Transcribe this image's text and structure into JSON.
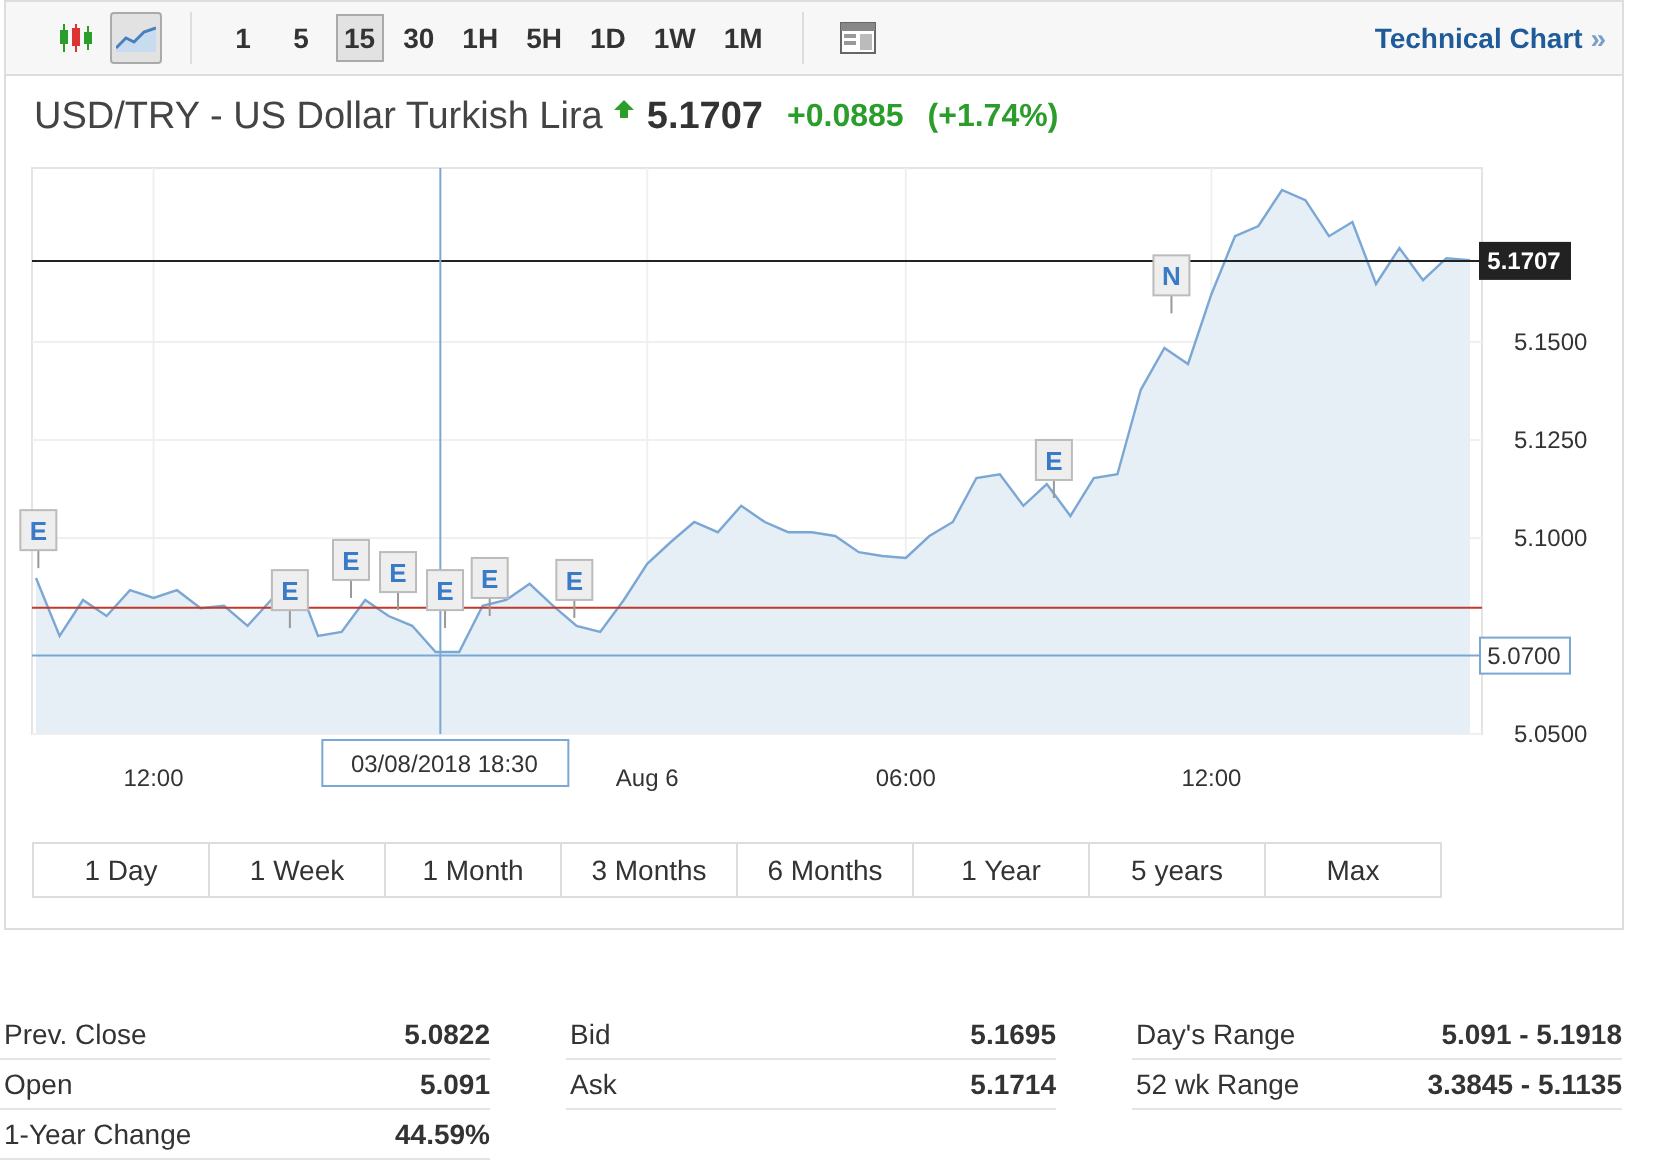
{
  "toolbar": {
    "chart_types": [
      {
        "kind": "candlestick",
        "selected": false
      },
      {
        "kind": "line",
        "selected": true
      }
    ],
    "intervals": [
      {
        "label": "1",
        "selected": false
      },
      {
        "label": "5",
        "selected": false
      },
      {
        "label": "15",
        "selected": true
      },
      {
        "label": "30",
        "selected": false
      },
      {
        "label": "1H",
        "selected": false
      },
      {
        "label": "5H",
        "selected": false
      },
      {
        "label": "1D",
        "selected": false
      },
      {
        "label": "1W",
        "selected": false
      },
      {
        "label": "1M",
        "selected": false
      }
    ],
    "link": "Technical Chart",
    "link_arrow": "»"
  },
  "quote": {
    "name": "USD/TRY - US Dollar Turkish Lira",
    "price": "5.1707",
    "change": "+0.0885",
    "change_percent": "(+1.74%)"
  },
  "chart": {
    "crosshair_time": "03/08/2018 18:30",
    "event_markers": [
      {
        "text": "E"
      },
      {
        "text": "E"
      },
      {
        "text": "E"
      },
      {
        "text": "E"
      },
      {
        "text": "E"
      },
      {
        "text": "E"
      },
      {
        "text": "E"
      },
      {
        "text": "E"
      },
      {
        "text": "N"
      }
    ],
    "chart_data": {
      "type": "area",
      "grid": true,
      "ylim": [
        5.05,
        5.1944
      ],
      "categories": [
        null,
        null,
        null,
        null,
        null,
        "12:00",
        null,
        null,
        null,
        null,
        null,
        null,
        null,
        null,
        null,
        null,
        null,
        null,
        null,
        null,
        null,
        null,
        null,
        null,
        null,
        null,
        "Aug 6",
        null,
        null,
        null,
        null,
        null,
        null,
        null,
        null,
        null,
        null,
        "06:00",
        null,
        null,
        null,
        null,
        null,
        null,
        null,
        null,
        null,
        null,
        null,
        null,
        "12:00",
        null,
        null,
        null,
        null,
        null,
        null,
        null,
        null,
        null,
        null,
        null
      ],
      "yticks": [
        {
          "value": 5.05,
          "label": "5.0500"
        },
        {
          "value": 5.1,
          "label": "5.1000"
        },
        {
          "value": 5.125,
          "label": "5.1250"
        },
        {
          "value": 5.15,
          "label": "5.1500"
        }
      ],
      "series": [
        {
          "color": "#7ba7d4",
          "values": [
            5.0898,
            5.075,
            5.0842,
            5.0801,
            5.0867,
            5.0847,
            5.0867,
            5.0821,
            5.0827,
            5.0776,
            5.0842,
            5.0908,
            5.075,
            5.076,
            5.0842,
            5.0801,
            5.0776,
            5.0709,
            5.0709,
            5.0827,
            5.0842,
            5.0883,
            5.0827,
            5.0776,
            5.076,
            5.0842,
            5.0934,
            5.099,
            5.1041,
            5.1015,
            5.1082,
            5.1041,
            5.1015,
            5.1015,
            5.1005,
            5.0964,
            5.0954,
            5.0949,
            5.1005,
            5.1041,
            5.1153,
            5.1163,
            5.1082,
            5.1138,
            5.1056,
            5.1153,
            5.1163,
            5.1378,
            5.1485,
            5.1444,
            5.1622,
            5.177,
            5.1796,
            5.1888,
            5.1862,
            5.177,
            5.1806,
            5.1648,
            5.174,
            5.1658,
            5.1714,
            5.1709
          ]
        }
      ],
      "ref_lines": [
        {
          "axis": "y",
          "value": 5.1707,
          "label": "5.1707"
        },
        {
          "axis": "y",
          "value": 5.0822
        },
        {
          "axis": "y",
          "value": 5.07,
          "label": "5.0700"
        }
      ]
    }
  },
  "ranges": [
    {
      "label": "1 Day",
      "selected": false
    },
    {
      "label": "1 Week",
      "selected": false
    },
    {
      "label": "1 Month",
      "selected": false
    },
    {
      "label": "3 Months",
      "selected": false
    },
    {
      "label": "6 Months",
      "selected": false
    },
    {
      "label": "1 Year",
      "selected": false
    },
    {
      "label": "5 years",
      "selected": false
    },
    {
      "label": "Max",
      "selected": false
    }
  ],
  "stats": [
    [
      {
        "label": "Prev. Close",
        "value": "5.0822"
      },
      {
        "label": "Open",
        "value": "5.091"
      },
      {
        "label": "1-Year Change",
        "value": "44.59%"
      }
    ],
    [
      {
        "label": "Bid",
        "value": "5.1695"
      },
      {
        "label": "Ask",
        "value": "5.1714"
      }
    ],
    [
      {
        "label": "Day's Range",
        "value": "5.091 - 5.1918"
      },
      {
        "label": "52 wk Range",
        "value": "3.3845 - 5.1135"
      }
    ]
  ]
}
